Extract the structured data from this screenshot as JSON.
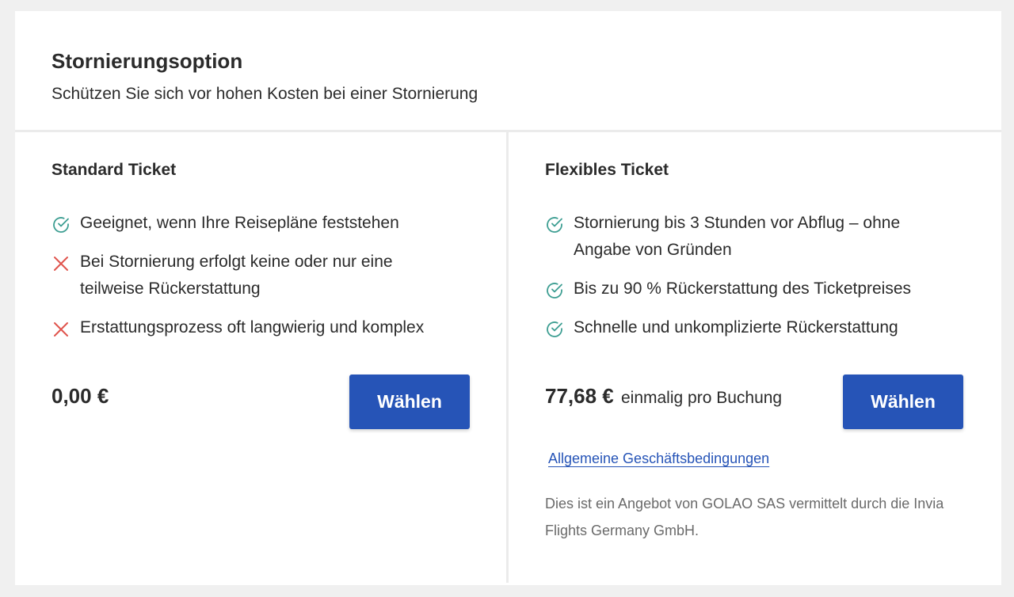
{
  "header": {
    "title": "Stornierungsoption",
    "subtitle": "Schützen Sie sich vor hohen Kosten bei einer Stornierung"
  },
  "standard": {
    "title": "Standard Ticket",
    "features": [
      {
        "icon": "check-circle-icon",
        "text": "Geeignet, wenn Ihre Reisepläne feststehen"
      },
      {
        "icon": "cross-icon",
        "text": "Bei Stornierung erfolgt keine oder nur eine teilweise Rückerstattung"
      },
      {
        "icon": "cross-icon",
        "text": "Erstattungsprozess oft langwierig und komplex"
      }
    ],
    "price": "0,00 €",
    "button_label": "Wählen"
  },
  "flexible": {
    "title": "Flexibles Ticket",
    "features": [
      {
        "icon": "check-circle-icon",
        "text": "Stornierung bis 3 Stunden vor Abflug – ohne Angabe von Gründen"
      },
      {
        "icon": "check-circle-icon",
        "text": "Bis zu 90 % Rückerstattung des Ticketpreises"
      },
      {
        "icon": "check-circle-icon",
        "text": "Schnelle und unkomplizierte Rückerstattung"
      }
    ],
    "price": "77,68 €",
    "price_note": "einmalig pro Buchung",
    "button_label": "Wählen",
    "terms_link": "Allgemeine Geschäftsbedingungen",
    "disclaimer": "Dies ist ein Angebot von GOLAO SAS vermittelt durch die Invia Flights Germany GmbH."
  },
  "colors": {
    "accent": "#2654b7",
    "check": "#3d9e92",
    "cross": "#e0544d"
  }
}
